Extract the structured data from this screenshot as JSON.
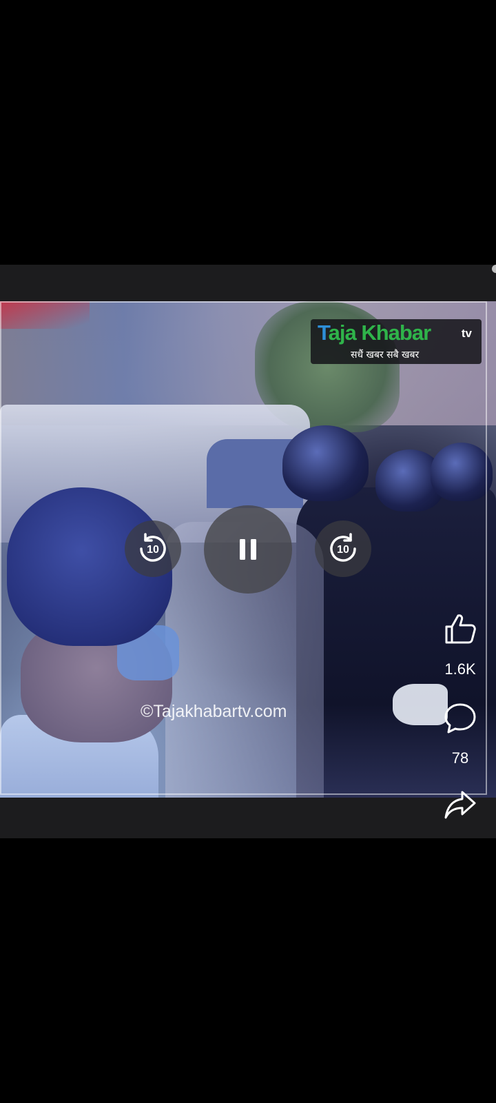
{
  "video": {
    "logo": {
      "brand": "Taja Khabar",
      "brand_first_letter": "T",
      "brand_rest": "aja Khabar",
      "suffix": "tv",
      "tagline": "सधैं खबर सबै खबर"
    },
    "watermark": "©Tajakhabartv.com",
    "controls": {
      "rewind_seconds": "10",
      "forward_seconds": "10",
      "state": "playing",
      "pause_icon": "pause-icon",
      "rewind_icon": "replay-10-icon",
      "forward_icon": "forward-10-icon"
    }
  },
  "actions": {
    "like": {
      "icon": "thumbs-up-icon",
      "count": "1.6K"
    },
    "comment": {
      "icon": "comment-bubble-icon",
      "count": "78"
    },
    "share": {
      "icon": "share-arrow-icon"
    }
  },
  "colors": {
    "background": "#000000",
    "frame": "#1c1c1e",
    "logo_green": "#2fb44a",
    "logo_blue": "#2e8fd8"
  }
}
